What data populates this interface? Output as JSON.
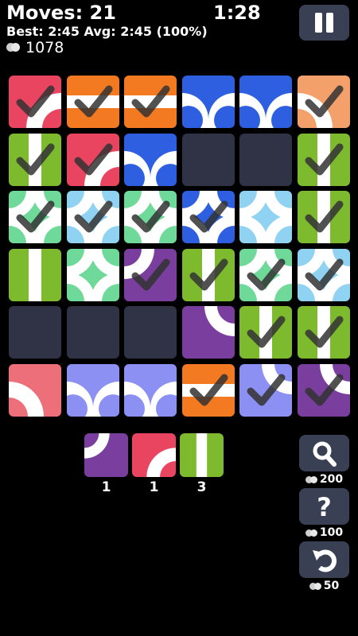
{
  "header": {
    "moves": "Moves: 21",
    "timer": "1:28",
    "stats": "Best: 2:45 Avg: 2:45 (100%)",
    "coins": "1078"
  },
  "colors": {
    "red": "#e94560",
    "orange": "#f47a22",
    "peach": "#f4a06b",
    "blue": "#2d5fe0",
    "green": "#7dba2e",
    "mint": "#6fd99a",
    "sky": "#8fd2f2",
    "purple": "#7a3f9e",
    "pink": "#ec6f7a",
    "lavender": "#8b90f2",
    "empty": "#2f3345"
  },
  "grid": [
    [
      {
        "c": "red",
        "p": "arcBR",
        "chk": true
      },
      {
        "c": "orange",
        "p": "hbar",
        "chk": true
      },
      {
        "c": "orange",
        "p": "hbar",
        "chk": true
      },
      {
        "c": "blue",
        "p": "bump",
        "chk": false
      },
      {
        "c": "blue",
        "p": "bump",
        "chk": false
      },
      {
        "c": "peach",
        "p": "arcBL",
        "chk": true
      }
    ],
    [
      {
        "c": "green",
        "p": "vbar",
        "chk": true
      },
      {
        "c": "red",
        "p": "arcBR",
        "chk": true
      },
      {
        "c": "blue",
        "p": "bump",
        "chk": false
      },
      {
        "c": "empty",
        "p": "none",
        "chk": false
      },
      {
        "c": "empty",
        "p": "none",
        "chk": false
      },
      {
        "c": "green",
        "p": "vbar",
        "chk": true
      }
    ],
    [
      {
        "c": "mint",
        "p": "cross",
        "chk": true
      },
      {
        "c": "sky",
        "p": "cross",
        "chk": true
      },
      {
        "c": "mint",
        "p": "cross",
        "chk": true
      },
      {
        "c": "blue",
        "p": "cross",
        "chk": true
      },
      {
        "c": "sky",
        "p": "cross",
        "chk": false
      },
      {
        "c": "green",
        "p": "vbar",
        "chk": true
      }
    ],
    [
      {
        "c": "green",
        "p": "vbar",
        "chk": false
      },
      {
        "c": "mint",
        "p": "cross",
        "chk": false
      },
      {
        "c": "purple",
        "p": "arcTL",
        "chk": true
      },
      {
        "c": "green",
        "p": "vbar",
        "chk": true
      },
      {
        "c": "mint",
        "p": "cross",
        "chk": true
      },
      {
        "c": "sky",
        "p": "cross",
        "chk": true
      }
    ],
    [
      {
        "c": "empty",
        "p": "none",
        "chk": false
      },
      {
        "c": "empty",
        "p": "none",
        "chk": false
      },
      {
        "c": "empty",
        "p": "none",
        "chk": false
      },
      {
        "c": "purple",
        "p": "arcTR",
        "chk": false
      },
      {
        "c": "green",
        "p": "vbar",
        "chk": true
      },
      {
        "c": "green",
        "p": "vbar",
        "chk": true
      }
    ],
    [
      {
        "c": "pink",
        "p": "arcBL",
        "chk": false
      },
      {
        "c": "lavender",
        "p": "bump",
        "chk": false
      },
      {
        "c": "lavender",
        "p": "bump",
        "chk": false
      },
      {
        "c": "orange",
        "p": "hbar",
        "chk": true
      },
      {
        "c": "lavender",
        "p": "arcTR",
        "chk": true
      },
      {
        "c": "purple",
        "p": "arcTR",
        "chk": true
      }
    ]
  ],
  "inventory": [
    {
      "c": "purple",
      "p": "arcTL",
      "count": "1"
    },
    {
      "c": "red",
      "p": "arcBR",
      "count": "1"
    },
    {
      "c": "green",
      "p": "vbar",
      "count": "3"
    }
  ],
  "powerups": [
    {
      "name": "hint",
      "icon": "magnifier-icon",
      "price": "200"
    },
    {
      "name": "reveal",
      "icon": "question-icon",
      "price": "100"
    },
    {
      "name": "undo",
      "icon": "undo-icon",
      "price": "50"
    }
  ]
}
